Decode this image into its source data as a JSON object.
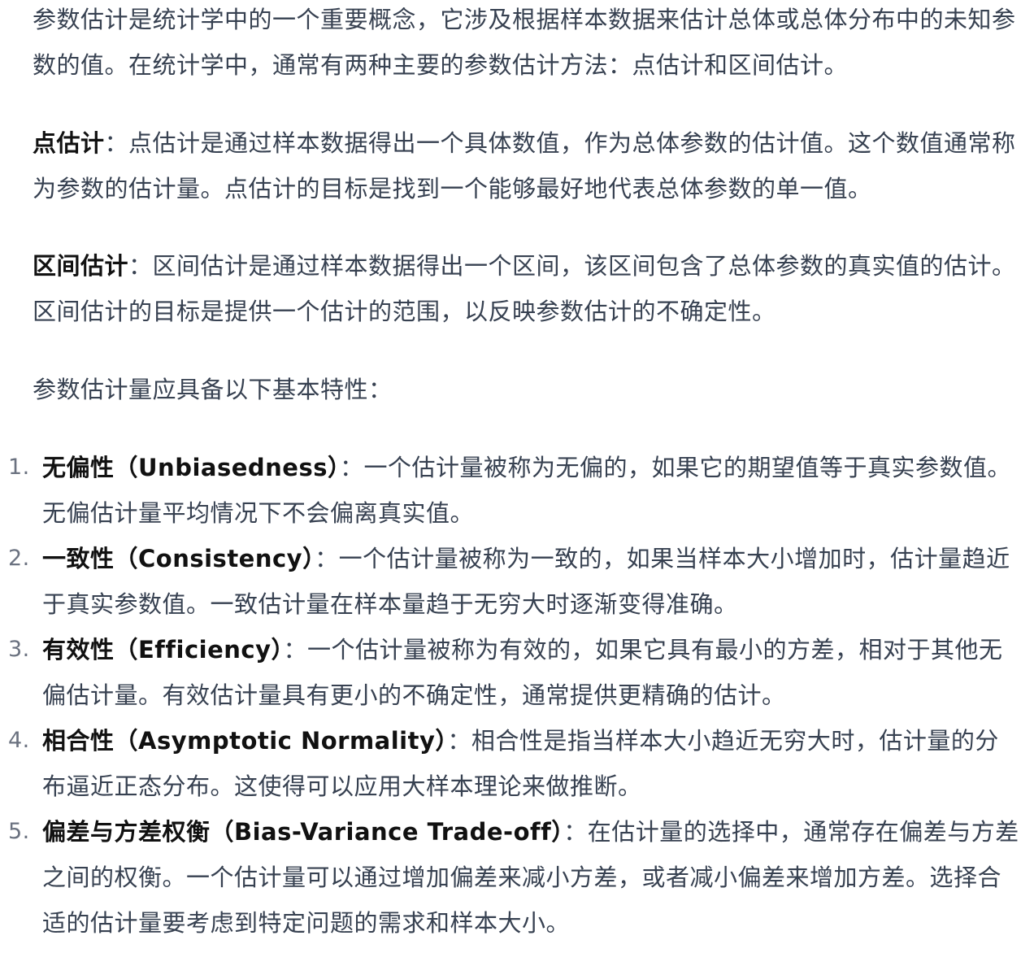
{
  "intro": "参数估计是统计学中的一个重要概念，它涉及根据样本数据来估计总体或总体分布中的未知参数的值。在统计学中，通常有两种主要的参数估计方法：点估计和区间估计。",
  "point_estimate": {
    "term": "点估计",
    "sep": "：",
    "text": "点估计是通过样本数据得出一个具体数值，作为总体参数的估计值。这个数值通常称为参数的估计量。点估计的目标是找到一个能够最好地代表总体参数的单一值。"
  },
  "interval_estimate": {
    "term": "区间估计",
    "sep": "：",
    "text": "区间估计是通过样本数据得出一个区间，该区间包含了总体参数的真实值的估计。区间估计的目标是提供一个估计的范围，以反映参数估计的不确定性。"
  },
  "properties_intro": "参数估计量应具备以下基本特性：",
  "properties": [
    {
      "number": "1.",
      "term": "无偏性（Unbiasedness）",
      "sep": "：",
      "text": "一个估计量被称为无偏的，如果它的期望值等于真实参数值。无偏估计量平均情况下不会偏离真实值。"
    },
    {
      "number": "2.",
      "term": "一致性（Consistency）",
      "sep": "：",
      "text": "一个估计量被称为一致的，如果当样本大小增加时，估计量趋近于真实参数值。一致估计量在样本量趋于无穷大时逐渐变得准确。"
    },
    {
      "number": "3.",
      "term": "有效性（Efficiency）",
      "sep": "：",
      "text": "一个估计量被称为有效的，如果它具有最小的方差，相对于其他无偏估计量。有效估计量具有更小的不确定性，通常提供更精确的估计。"
    },
    {
      "number": "4.",
      "term": "相合性（Asymptotic Normality）",
      "sep": "：",
      "text": "相合性是指当样本大小趋近无穷大时，估计量的分布逼近正态分布。这使得可以应用大样本理论来做推断。"
    },
    {
      "number": "5.",
      "term": "偏差与方差权衡（Bias-Variance Trade-off）",
      "sep": "：",
      "text": "在估计量的选择中，通常存在偏差与方差之间的权衡。一个估计量可以通过增加偏差来减小方差，或者减小偏差来增加方差。选择合适的估计量要考虑到特定问题的需求和样本大小。"
    }
  ]
}
